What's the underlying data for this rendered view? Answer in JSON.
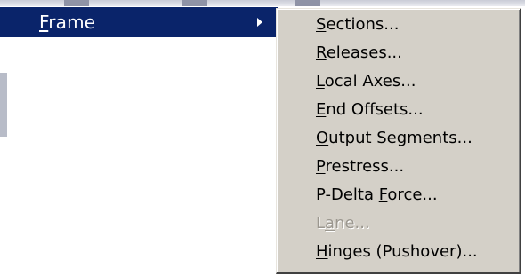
{
  "parent_item": {
    "label": "Frame",
    "mnemonic": "F",
    "highlight_color": "#0a246a",
    "has_submenu": true
  },
  "submenu": {
    "background": "#d4d0c8",
    "items": [
      {
        "label": "Sections...",
        "mnemonic": "S",
        "enabled": true
      },
      {
        "label": "Releases...",
        "mnemonic": "R",
        "enabled": true
      },
      {
        "label": "Local Axes...",
        "mnemonic": "L",
        "enabled": true
      },
      {
        "label": "End Offsets...",
        "mnemonic": "E",
        "enabled": true
      },
      {
        "label": "Output Segments...",
        "mnemonic": "O",
        "enabled": true
      },
      {
        "label": "Prestress...",
        "mnemonic": "P",
        "enabled": true
      },
      {
        "label": "P-Delta Force...",
        "mnemonic": "F",
        "enabled": true
      },
      {
        "label": "Lane...",
        "mnemonic": "a",
        "enabled": false
      },
      {
        "label": "Hinges (Pushover)...",
        "mnemonic": "H",
        "enabled": true
      }
    ]
  }
}
